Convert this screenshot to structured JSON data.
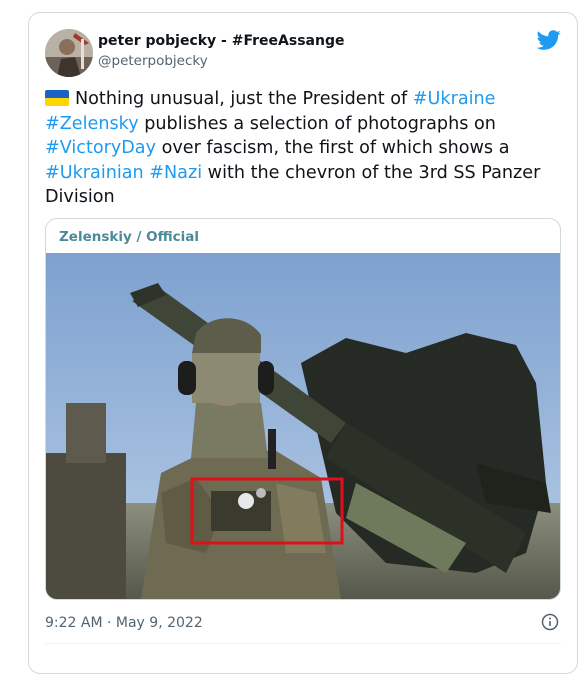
{
  "tweet": {
    "display_name": "peter pobjecky - #FreeAssange",
    "handle": "@peterpobjecky",
    "text_segments": [
      {
        "text": "Nothing unusual, just the President of ",
        "type": "plain"
      },
      {
        "text": "#Ukraine",
        "type": "hashtag"
      },
      {
        "text": " ",
        "type": "plain"
      },
      {
        "text": "#Zelensky",
        "type": "hashtag"
      },
      {
        "text": " publishes a selection of photographs on ",
        "type": "plain"
      },
      {
        "text": "#VictoryDay",
        "type": "hashtag"
      },
      {
        "text": " over fascism, the first of which shows a ",
        "type": "plain"
      },
      {
        "text": "#Ukrainian",
        "type": "hashtag"
      },
      {
        "text": " ",
        "type": "plain"
      },
      {
        "text": "#Nazi",
        "type": "hashtag"
      },
      {
        "text": " with the chevron of the 3rd SS Panzer Division",
        "type": "plain"
      }
    ],
    "leading_emoji": "ukraine-flag-icon",
    "media": {
      "caption": "Zelenskiy / Official",
      "highlight_color": "#e0101a"
    },
    "timestamp": "9:22 AM · May 9, 2022"
  },
  "icons": {
    "brand": "twitter-bird-icon",
    "info": "info-icon"
  },
  "colors": {
    "link": "#1d9bf0",
    "muted": "#536471",
    "border": "#cfd9de"
  }
}
